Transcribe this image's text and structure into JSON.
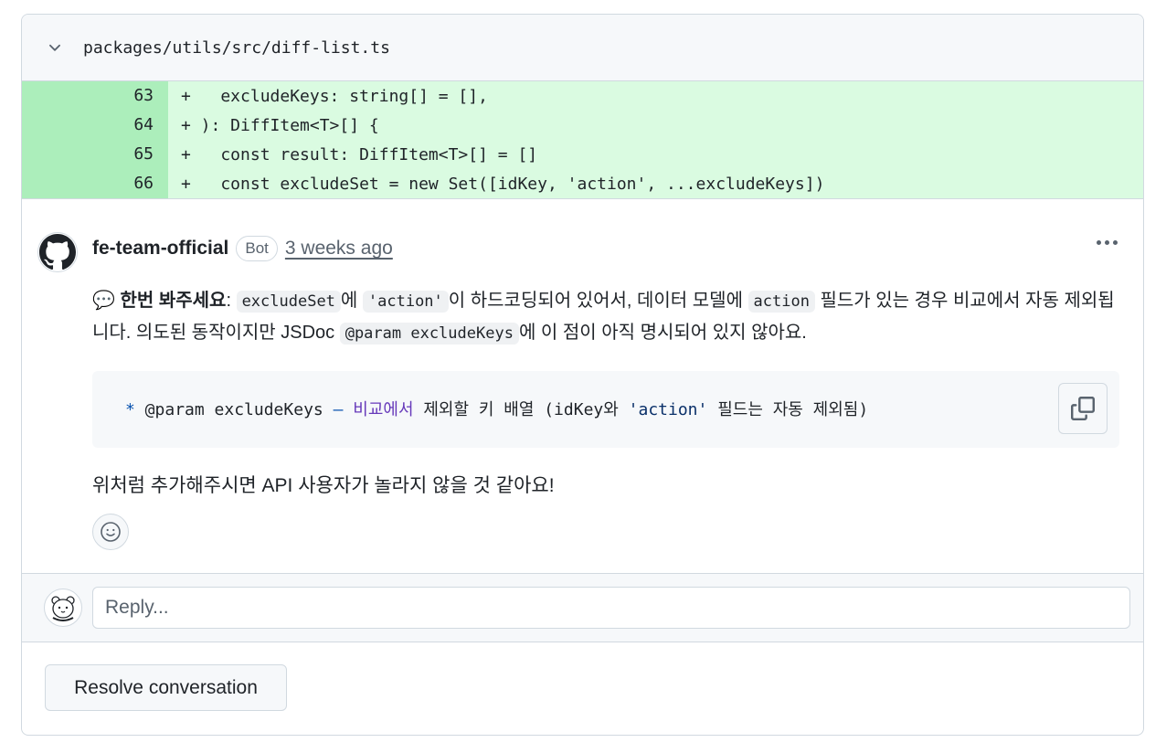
{
  "file": {
    "path": "packages/utils/src/diff-list.ts"
  },
  "diff_lines": [
    {
      "num": "63",
      "code": "+   excludeKeys: string[] = [],"
    },
    {
      "num": "64",
      "code": "+ ): DiffItem<T>[] {"
    },
    {
      "num": "65",
      "code": "+   const result: DiffItem<T>[] = []"
    },
    {
      "num": "66",
      "code": "+   const excludeSet = new Set([idKey, 'action', ...excludeKeys])"
    }
  ],
  "comment": {
    "author": "fe-team-official",
    "badge": "Bot",
    "time": "3 weeks ago",
    "emoji": "💬",
    "bold_lead": "한번 봐주세요",
    "t1": ": ",
    "c1": "excludeSet",
    "t2": "에 ",
    "c2": "'action'",
    "t3": "이 하드코딩되어 있어서, 데이터 모델에 ",
    "c3": "action",
    "t4": " 필드가 있는 경우 비교에서 자동 제외됩니다. 의도된 동작이지만 JSDoc ",
    "c4": "@param excludeKeys",
    "t5": "에 이 점이 아직 명시되어 있지 않아요.",
    "snippet": {
      "star": "*",
      "param": " @param excludeKeys ",
      "dash": "–",
      "word": " 비교에서",
      "rest": " 제외할 키 배열 (idKey와 ",
      "str": "'action'",
      "tail": " 필드는 자동 제외됨)"
    },
    "followup": "위처럼 추가해주시면 API 사용자가 놀라지 않을 것 같아요!"
  },
  "reply": {
    "placeholder": "Reply..."
  },
  "resolve_label": "Resolve conversation"
}
